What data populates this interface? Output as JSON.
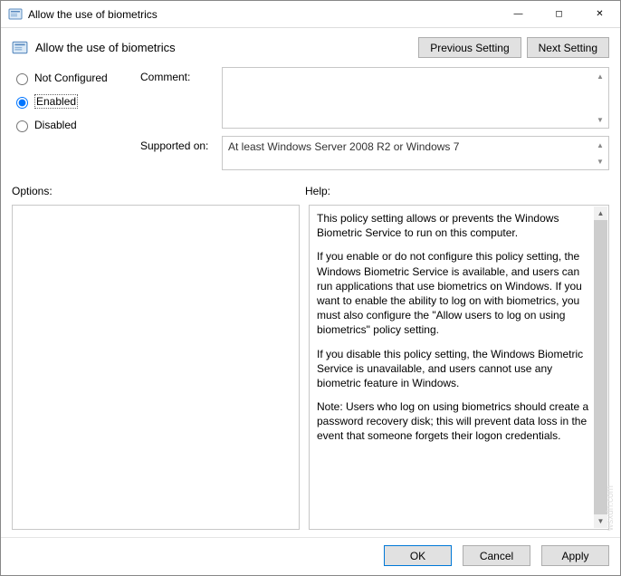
{
  "window": {
    "title": "Allow the use of biometrics"
  },
  "header": {
    "title": "Allow the use of biometrics",
    "prev_btn": "Previous Setting",
    "next_btn": "Next Setting"
  },
  "state": {
    "options": [
      {
        "value": "not_configured",
        "label": "Not Configured"
      },
      {
        "value": "enabled",
        "label": "Enabled"
      },
      {
        "value": "disabled",
        "label": "Disabled"
      }
    ],
    "selected": "enabled"
  },
  "labels": {
    "comment": "Comment:",
    "supported_on": "Supported on:",
    "options": "Options:",
    "help": "Help:"
  },
  "fields": {
    "comment": "",
    "supported_on": "At least Windows Server 2008 R2 or Windows 7"
  },
  "help_paragraphs": [
    "This policy setting allows or prevents the Windows Biometric Service to run on this computer.",
    "If you enable or do not configure this policy setting, the Windows Biometric Service is available, and users can run applications that use biometrics on Windows. If you want to enable the ability to log on with biometrics, you must also configure the \"Allow users to log on using biometrics\" policy setting.",
    "If you disable this policy setting, the Windows Biometric Service is unavailable, and users cannot use any biometric feature in Windows.",
    "Note: Users who log on using biometrics should create a password recovery disk; this will prevent data loss in the event that someone forgets their logon credentials."
  ],
  "footer": {
    "ok": "OK",
    "cancel": "Cancel",
    "apply": "Apply"
  },
  "watermark": "wsxdn.com"
}
